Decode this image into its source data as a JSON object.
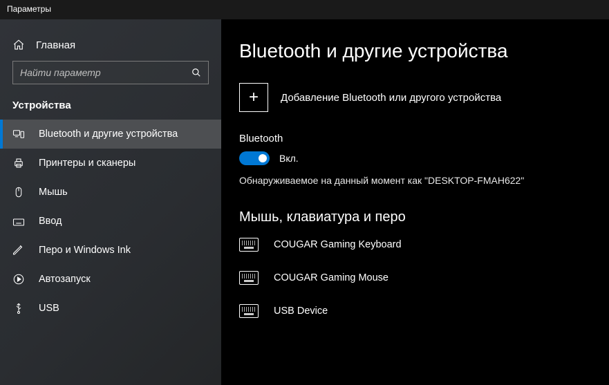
{
  "window": {
    "title": "Параметры"
  },
  "sidebar": {
    "home": "Главная",
    "search_placeholder": "Найти параметр",
    "section": "Устройства",
    "items": [
      {
        "label": "Bluetooth и другие устройства",
        "icon": "devices-icon",
        "active": true
      },
      {
        "label": "Принтеры и сканеры",
        "icon": "printer-icon",
        "active": false
      },
      {
        "label": "Мышь",
        "icon": "mouse-icon",
        "active": false
      },
      {
        "label": "Ввод",
        "icon": "keyboard-icon",
        "active": false
      },
      {
        "label": "Перо и Windows Ink",
        "icon": "pen-icon",
        "active": false
      },
      {
        "label": "Автозапуск",
        "icon": "autoplay-icon",
        "active": false
      },
      {
        "label": "USB",
        "icon": "usb-icon",
        "active": false
      }
    ]
  },
  "main": {
    "heading": "Bluetooth и другие устройства",
    "add_label": "Добавление Bluetooth или другого устройства",
    "bt_title": "Bluetooth",
    "bt_state": "Вкл.",
    "bt_on": true,
    "discoverable": "Обнаруживаемое на данный момент как \"DESKTOP-FMAH622\"",
    "devices_heading": "Мышь, клавиатура и перо",
    "devices": [
      {
        "name": "COUGAR Gaming Keyboard"
      },
      {
        "name": "COUGAR Gaming Mouse"
      },
      {
        "name": "USB Device"
      }
    ]
  },
  "annotation": {
    "arrow_color": "#d40000"
  }
}
